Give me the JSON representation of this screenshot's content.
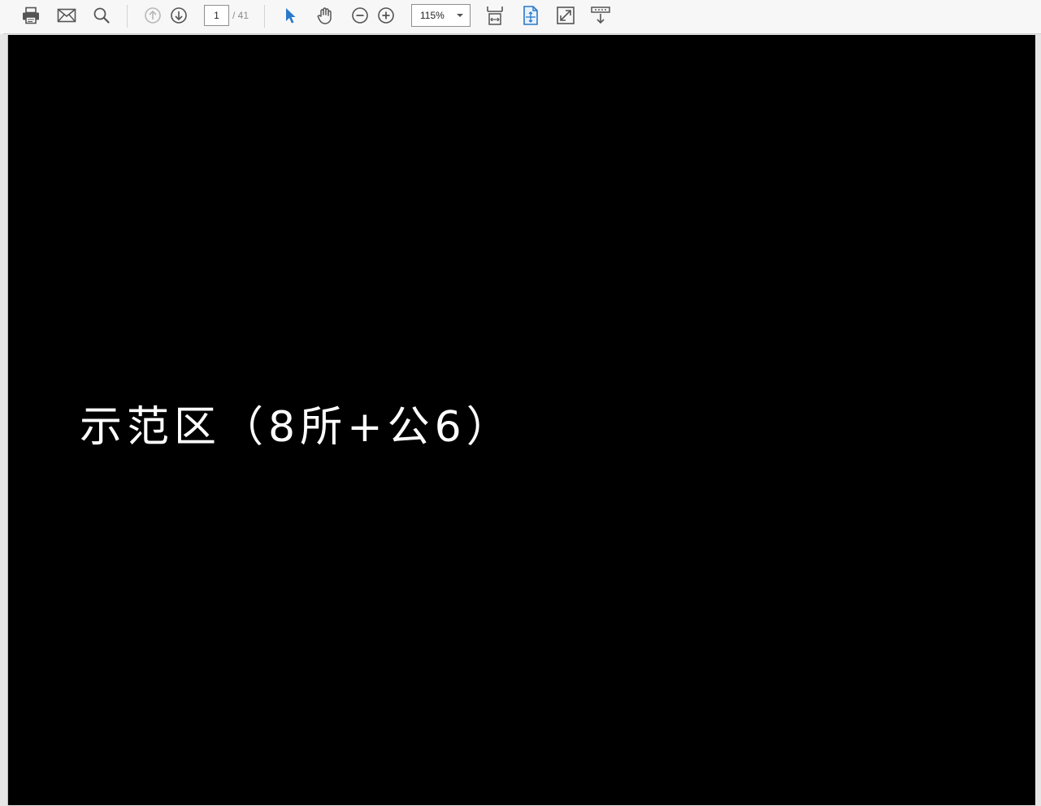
{
  "toolbar": {
    "page_current": "1",
    "page_total": "/ 41",
    "zoom_value": "115%",
    "icons": {
      "print": "print-icon",
      "email": "email-icon",
      "search": "search-icon",
      "prev_page": "arrow-up-circle-icon",
      "next_page": "arrow-down-circle-icon",
      "select": "select-arrow-icon",
      "hand": "hand-pan-icon",
      "zoom_out": "zoom-out-icon",
      "zoom_in": "zoom-in-icon",
      "scroll_mode": "scroll-mode-icon",
      "fit_page": "fit-page-icon",
      "fullscreen": "fullscreen-icon",
      "tools": "tools-dropdown-icon"
    },
    "colors": {
      "accent": "#2a78c8",
      "icon": "#555555",
      "disabled": "#b8b8b8"
    }
  },
  "document": {
    "background": "#000000",
    "title_text": "示范区（8所+公6）"
  }
}
